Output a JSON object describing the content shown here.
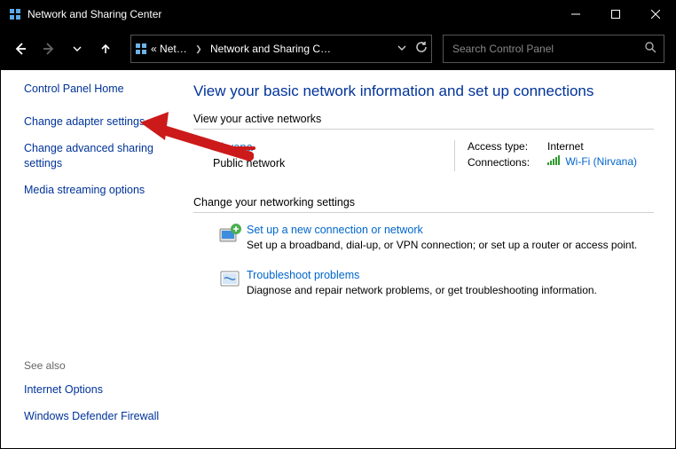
{
  "window": {
    "title": "Network and Sharing Center"
  },
  "breadcrumb": {
    "prefix": "«",
    "part1": "Net…",
    "part2": "Network and Sharing C…"
  },
  "search": {
    "placeholder": "Search Control Panel"
  },
  "sidebar": {
    "home": "Control Panel Home",
    "links": [
      "Change adapter settings",
      "Change advanced sharing settings",
      "Media streaming options"
    ],
    "seealso_label": "See also",
    "seealso": [
      "Internet Options",
      "Windows Defender Firewall"
    ]
  },
  "main": {
    "heading": "View your basic network information and set up connections",
    "active_title": "View your active networks",
    "network": {
      "name": "Nirvana",
      "type": "Public network",
      "access_label": "Access type:",
      "access_value": "Internet",
      "conn_label": "Connections:",
      "conn_value": "Wi-Fi (Nirvana)"
    },
    "change_title": "Change your networking settings",
    "items": [
      {
        "title": "Set up a new connection or network",
        "desc": "Set up a broadband, dial-up, or VPN connection; or set up a router or access point."
      },
      {
        "title": "Troubleshoot problems",
        "desc": "Diagnose and repair network problems, or get troubleshooting information."
      }
    ]
  }
}
